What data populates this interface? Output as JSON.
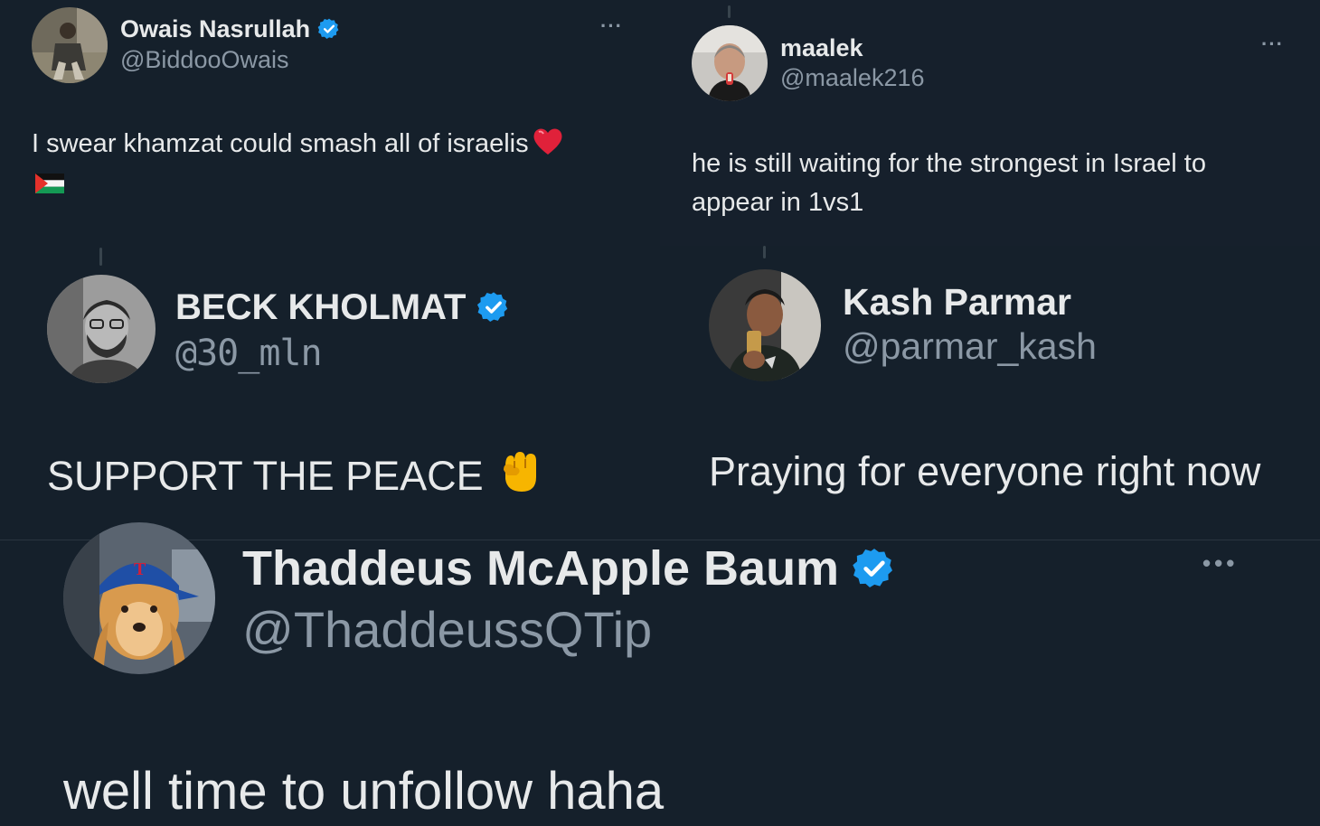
{
  "colors": {
    "background": "#15202b",
    "text": "#e7e9ea",
    "secondary_text": "#8b98a5",
    "verified": "#1d9bf0"
  },
  "tweets": [
    {
      "display_name": "Owais Nasrullah",
      "handle": "@BiddooOwais",
      "verified": true,
      "more": "···",
      "text": "I swear khamzat could smash all of israelis",
      "emoji": [
        "heart",
        "palestine-flag"
      ]
    },
    {
      "display_name": "maalek",
      "handle": "@maalek216",
      "verified": false,
      "more": "···",
      "text_lines": [
        "he is still waiting for the strongest in Israel to",
        "appear in 1vs1"
      ]
    },
    {
      "display_name": "BECK KHOLMAT",
      "handle": "@30_mln",
      "verified": true,
      "text": "SUPPORT THE PEACE",
      "emoji": [
        "raised-fist"
      ]
    },
    {
      "display_name": "Kash Parmar",
      "handle": "@parmar_kash",
      "verified": false,
      "text": "Praying for everyone right now"
    },
    {
      "display_name": "Thaddeus McApple Baum",
      "handle": "@ThaddeussQTip",
      "verified": true,
      "more": "•••",
      "text": "well time to unfollow haha"
    }
  ]
}
